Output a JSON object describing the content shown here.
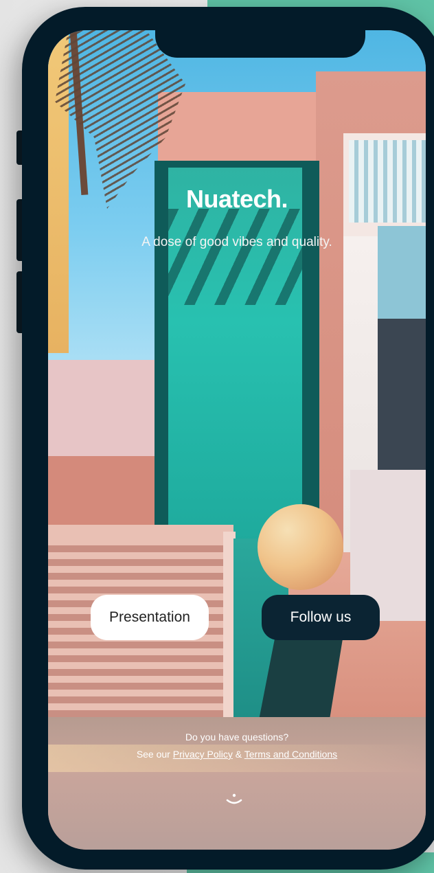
{
  "app": {
    "brand": "Nuatech.",
    "tagline": "A dose of good vibes and quality."
  },
  "actions": {
    "primary_label": "Presentation",
    "secondary_label": "Follow us"
  },
  "footer": {
    "question": "Do you have questions?",
    "see_our": "See our",
    "privacy_link": "Privacy Policy",
    "ampersand": "&",
    "terms_link": "Terms and Conditions"
  },
  "icons": {
    "bottom": "smile-icon"
  },
  "colors": {
    "accent_teal": "#5fc3a6",
    "device_frame": "#031b29",
    "button_dark": "#0b2433",
    "button_light": "#ffffff"
  }
}
